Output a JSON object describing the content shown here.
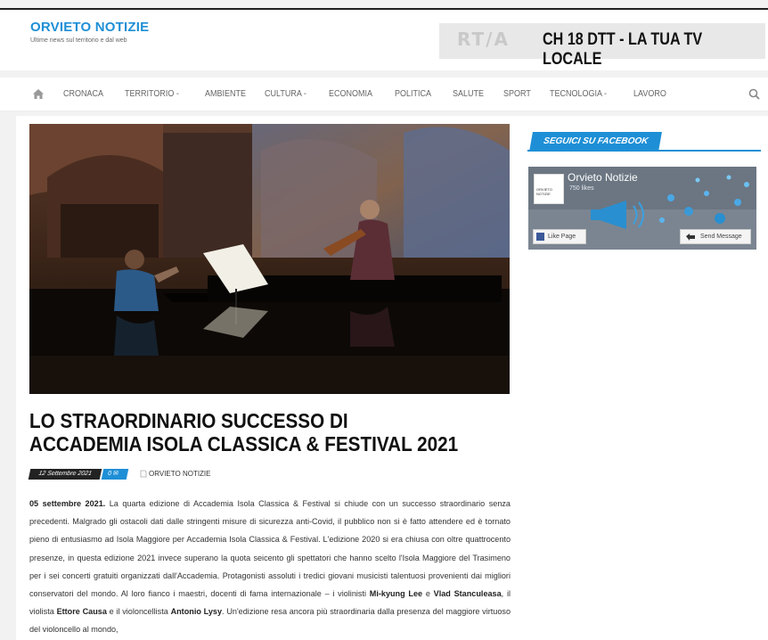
{
  "site": {
    "title": "ORVIETO NOTIZIE",
    "tagline": "Ultime news sul territorio e dal web"
  },
  "banner": {
    "logo": "RT/A",
    "text": "CH 18 DTT - LA TUA TV LOCALE"
  },
  "nav": {
    "items": [
      {
        "label": "CRONACA"
      },
      {
        "label": "TERRITORIO -"
      },
      {
        "label": "AMBIENTE"
      },
      {
        "label": "CULTURA -"
      },
      {
        "label": "ECONOMIA"
      },
      {
        "label": "POLITICA"
      },
      {
        "label": "SALUTE"
      },
      {
        "label": "SPORT"
      },
      {
        "label": "TECNOLOGIA -"
      },
      {
        "label": "LAVORO"
      }
    ]
  },
  "article": {
    "title": "LO STRAORDINARIO SUCCESSO DI ACCADEMIA ISOLA CLASSICA & FESTIVAL 2021",
    "date": "12 Settembre 2021",
    "comments": "0",
    "author": "ORVIETO NOTIZIE",
    "p_date": "05 settembre 2021.",
    "p1": " La quarta edizione di Accademia Isola Classica & Festival si chiude con un successo straordinario senza precedenti. Malgrado gli ostacoli dati dalle stringenti misure di sicurezza anti-Covid, il pubblico non si è fatto attendere ed è tornato pieno di entusiasmo ad Isola Maggiore per Accademia Isola Classica & Festival. L'edizione 2020 si era chiusa con oltre quattrocento presenze, in questa edizione 2021 invece superano la quota seicento gli spettatori che hanno scelto l'Isola Maggiore del Trasimeno per i sei concerti gratuiti organizzati dall'Accademia. Protagonisti assoluti i tredici giovani musicisti talentuosi provenienti dai migliori conservatori del mondo. Al loro fianco i maestri, docenti di fama internazionale – i violinisti ",
    "name1": "Mi-kyung Lee",
    "t_e": " e ",
    "name2": "Vlad Stanculeasa",
    "t_viola": ", il violista ",
    "name3": "Ettore Causa",
    "t_cello": " e il violoncellista ",
    "name4": "Antonio Lysy",
    "p2": ". Un'edizione resa ancora più straordinaria dalla presenza del maggiore virtuoso del violoncello al mondo,"
  },
  "sidebar": {
    "title": "SEGUICI SU FACEBOOK",
    "fb_name": "Orvieto Notizie",
    "fb_likes": "750 likes",
    "fb_thumb": "ORVIETO NOTIZIE",
    "like_label": "Like Page",
    "message_label": "Send Message"
  },
  "colors": {
    "accent": "#1e8fd6",
    "dark": "#222222"
  }
}
